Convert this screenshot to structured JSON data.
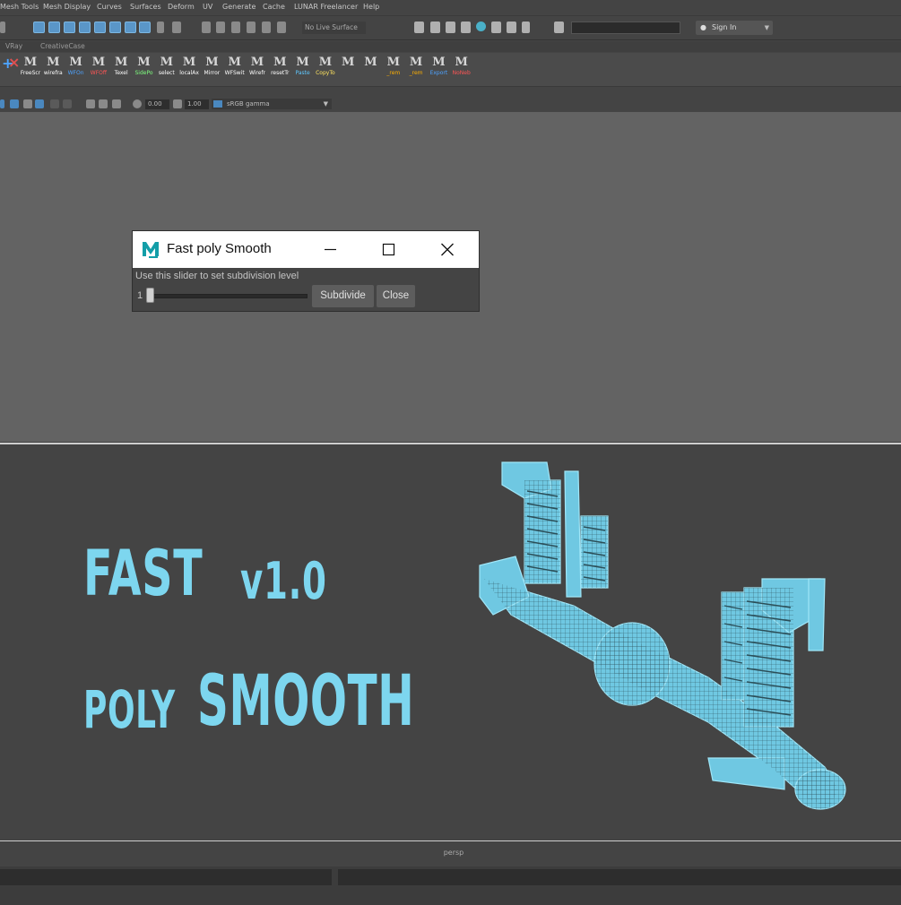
{
  "menubar": {
    "items": [
      "Mesh Tools",
      "Mesh Display",
      "Curves",
      "Surfaces",
      "Deform",
      "UV",
      "Generate",
      "Cache",
      "LUNAR Freelancer",
      "Help"
    ]
  },
  "statusline": {
    "live_surface": "No Live Surface",
    "sign_in": "Sign In"
  },
  "shelf_tabs": [
    "VRay",
    "CreativeCase"
  ],
  "shelf": {
    "buttons": [
      {
        "caption": "FreeScr",
        "color": "#ffffff"
      },
      {
        "caption": "wirefra",
        "color": "#ffffff"
      },
      {
        "caption": "WFOn",
        "color": "#4da3ff"
      },
      {
        "caption": "WFOff",
        "color": "#ff5555"
      },
      {
        "caption": "Texel",
        "color": "#ffffff"
      },
      {
        "caption": "SidePo",
        "color": "#7fff7f"
      },
      {
        "caption": "select",
        "color": "#ffffff"
      },
      {
        "caption": "localAx",
        "color": "#ffffff"
      },
      {
        "caption": "Mirror",
        "color": "#ffffff"
      },
      {
        "caption": "WFSwit",
        "color": "#ffffff"
      },
      {
        "caption": "Wirefr",
        "color": "#ffffff"
      },
      {
        "caption": "resetTr",
        "color": "#ffffff"
      },
      {
        "caption": "Paste",
        "color": "#5fc8ff"
      },
      {
        "caption": "CopyTo",
        "color": "#ffe45f"
      },
      {
        "caption": "",
        "color": "#ffffff"
      },
      {
        "caption": "",
        "color": "#ffffff"
      },
      {
        "caption": "_rem",
        "color": "#ffb000"
      },
      {
        "caption": "_rem",
        "color": "#ffb000"
      },
      {
        "caption": "Export",
        "color": "#4da3ff"
      },
      {
        "caption": "NoNeb",
        "color": "#ff5555"
      }
    ]
  },
  "panel_toolbar": {
    "exposure": "0.00",
    "gamma_value": "1.00",
    "color_space": "sRGB gamma"
  },
  "dialog": {
    "title": "Fast poly Smooth",
    "hint": "Use this slider to set subdivision level",
    "slider_value": "1",
    "slider_fraction": 0,
    "subdivide_label": "Subdivide",
    "close_label": "Close"
  },
  "banner": {
    "line1_big": "FAST",
    "line1_version": "v1.0",
    "line2_small": "POLY",
    "line2_big": "SMOOTH",
    "accent": "#7dd6ef"
  },
  "viewport": {
    "camera": "persp"
  }
}
